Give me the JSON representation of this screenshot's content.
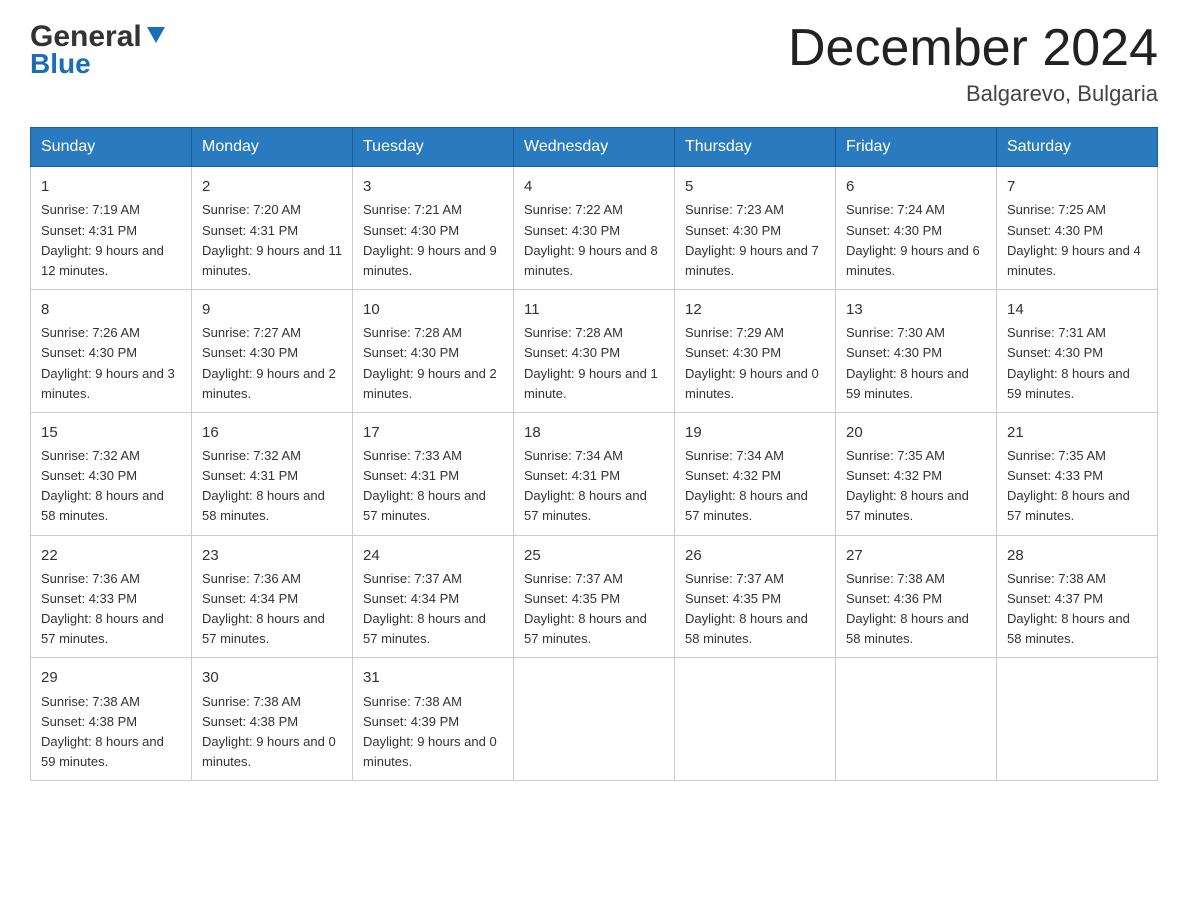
{
  "header": {
    "logo_general": "General",
    "logo_blue": "Blue",
    "month_title": "December 2024",
    "location": "Balgarevo, Bulgaria"
  },
  "days_of_week": [
    "Sunday",
    "Monday",
    "Tuesday",
    "Wednesday",
    "Thursday",
    "Friday",
    "Saturday"
  ],
  "weeks": [
    [
      {
        "day": "1",
        "sunrise": "7:19 AM",
        "sunset": "4:31 PM",
        "daylight": "9 hours and 12 minutes."
      },
      {
        "day": "2",
        "sunrise": "7:20 AM",
        "sunset": "4:31 PM",
        "daylight": "9 hours and 11 minutes."
      },
      {
        "day": "3",
        "sunrise": "7:21 AM",
        "sunset": "4:30 PM",
        "daylight": "9 hours and 9 minutes."
      },
      {
        "day": "4",
        "sunrise": "7:22 AM",
        "sunset": "4:30 PM",
        "daylight": "9 hours and 8 minutes."
      },
      {
        "day": "5",
        "sunrise": "7:23 AM",
        "sunset": "4:30 PM",
        "daylight": "9 hours and 7 minutes."
      },
      {
        "day": "6",
        "sunrise": "7:24 AM",
        "sunset": "4:30 PM",
        "daylight": "9 hours and 6 minutes."
      },
      {
        "day": "7",
        "sunrise": "7:25 AM",
        "sunset": "4:30 PM",
        "daylight": "9 hours and 4 minutes."
      }
    ],
    [
      {
        "day": "8",
        "sunrise": "7:26 AM",
        "sunset": "4:30 PM",
        "daylight": "9 hours and 3 minutes."
      },
      {
        "day": "9",
        "sunrise": "7:27 AM",
        "sunset": "4:30 PM",
        "daylight": "9 hours and 2 minutes."
      },
      {
        "day": "10",
        "sunrise": "7:28 AM",
        "sunset": "4:30 PM",
        "daylight": "9 hours and 2 minutes."
      },
      {
        "day": "11",
        "sunrise": "7:28 AM",
        "sunset": "4:30 PM",
        "daylight": "9 hours and 1 minute."
      },
      {
        "day": "12",
        "sunrise": "7:29 AM",
        "sunset": "4:30 PM",
        "daylight": "9 hours and 0 minutes."
      },
      {
        "day": "13",
        "sunrise": "7:30 AM",
        "sunset": "4:30 PM",
        "daylight": "8 hours and 59 minutes."
      },
      {
        "day": "14",
        "sunrise": "7:31 AM",
        "sunset": "4:30 PM",
        "daylight": "8 hours and 59 minutes."
      }
    ],
    [
      {
        "day": "15",
        "sunrise": "7:32 AM",
        "sunset": "4:30 PM",
        "daylight": "8 hours and 58 minutes."
      },
      {
        "day": "16",
        "sunrise": "7:32 AM",
        "sunset": "4:31 PM",
        "daylight": "8 hours and 58 minutes."
      },
      {
        "day": "17",
        "sunrise": "7:33 AM",
        "sunset": "4:31 PM",
        "daylight": "8 hours and 57 minutes."
      },
      {
        "day": "18",
        "sunrise": "7:34 AM",
        "sunset": "4:31 PM",
        "daylight": "8 hours and 57 minutes."
      },
      {
        "day": "19",
        "sunrise": "7:34 AM",
        "sunset": "4:32 PM",
        "daylight": "8 hours and 57 minutes."
      },
      {
        "day": "20",
        "sunrise": "7:35 AM",
        "sunset": "4:32 PM",
        "daylight": "8 hours and 57 minutes."
      },
      {
        "day": "21",
        "sunrise": "7:35 AM",
        "sunset": "4:33 PM",
        "daylight": "8 hours and 57 minutes."
      }
    ],
    [
      {
        "day": "22",
        "sunrise": "7:36 AM",
        "sunset": "4:33 PM",
        "daylight": "8 hours and 57 minutes."
      },
      {
        "day": "23",
        "sunrise": "7:36 AM",
        "sunset": "4:34 PM",
        "daylight": "8 hours and 57 minutes."
      },
      {
        "day": "24",
        "sunrise": "7:37 AM",
        "sunset": "4:34 PM",
        "daylight": "8 hours and 57 minutes."
      },
      {
        "day": "25",
        "sunrise": "7:37 AM",
        "sunset": "4:35 PM",
        "daylight": "8 hours and 57 minutes."
      },
      {
        "day": "26",
        "sunrise": "7:37 AM",
        "sunset": "4:35 PM",
        "daylight": "8 hours and 58 minutes."
      },
      {
        "day": "27",
        "sunrise": "7:38 AM",
        "sunset": "4:36 PM",
        "daylight": "8 hours and 58 minutes."
      },
      {
        "day": "28",
        "sunrise": "7:38 AM",
        "sunset": "4:37 PM",
        "daylight": "8 hours and 58 minutes."
      }
    ],
    [
      {
        "day": "29",
        "sunrise": "7:38 AM",
        "sunset": "4:38 PM",
        "daylight": "8 hours and 59 minutes."
      },
      {
        "day": "30",
        "sunrise": "7:38 AM",
        "sunset": "4:38 PM",
        "daylight": "9 hours and 0 minutes."
      },
      {
        "day": "31",
        "sunrise": "7:38 AM",
        "sunset": "4:39 PM",
        "daylight": "9 hours and 0 minutes."
      },
      null,
      null,
      null,
      null
    ]
  ],
  "labels": {
    "sunrise": "Sunrise:",
    "sunset": "Sunset:",
    "daylight": "Daylight:"
  }
}
